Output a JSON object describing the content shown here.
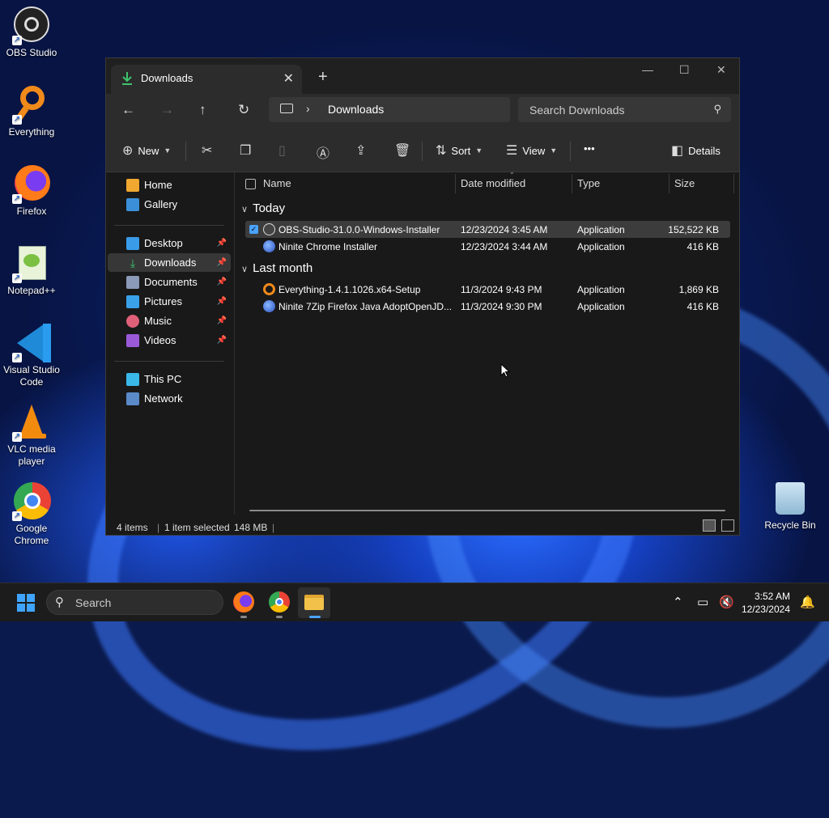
{
  "desktop": {
    "icons": [
      {
        "label": "OBS Studio"
      },
      {
        "label": "Everything"
      },
      {
        "label": "Firefox"
      },
      {
        "label": "Notepad++"
      },
      {
        "label": "Visual Studio Code"
      },
      {
        "label": "VLC media player"
      },
      {
        "label": "Google Chrome"
      }
    ],
    "recycle_bin": "Recycle Bin"
  },
  "window": {
    "tab_title": "Downloads",
    "new_tab": "+",
    "address": {
      "crumb": "Downloads"
    },
    "search_placeholder": "Search Downloads",
    "toolbar": {
      "new": "New",
      "sort": "Sort",
      "view": "View",
      "more": "•••",
      "details": "Details"
    },
    "sidebar": {
      "home": "Home",
      "gallery": "Gallery",
      "desktop": "Desktop",
      "downloads": "Downloads",
      "documents": "Documents",
      "pictures": "Pictures",
      "music": "Music",
      "videos": "Videos",
      "this_pc": "This PC",
      "network": "Network"
    },
    "columns": {
      "name": "Name",
      "date": "Date modified",
      "type": "Type",
      "size": "Size"
    },
    "groups": {
      "today": "Today",
      "last_month": "Last month"
    },
    "files": [
      {
        "name": "OBS-Studio-31.0.0-Windows-Installer",
        "date": "12/23/2024 3:45 AM",
        "type": "Application",
        "size": "152,522 KB"
      },
      {
        "name": "Ninite Chrome Installer",
        "date": "12/23/2024 3:44 AM",
        "type": "Application",
        "size": "416 KB"
      },
      {
        "name": "Everything-1.4.1.1026.x64-Setup",
        "date": "11/3/2024 9:43 PM",
        "type": "Application",
        "size": "1,869 KB"
      },
      {
        "name": "Ninite 7Zip Firefox Java AdoptOpenJD...",
        "date": "11/3/2024 9:30 PM",
        "type": "Application",
        "size": "416 KB"
      }
    ],
    "status": {
      "items": "4 items",
      "selected": "1 item selected",
      "size": "148 MB"
    }
  },
  "taskbar": {
    "search": "Search",
    "time": "3:52 AM",
    "date": "12/23/2024"
  },
  "colors": {
    "accent": "#4aa3ff",
    "window_bg": "#191919",
    "toolbar_bg": "#2c2c2c"
  }
}
